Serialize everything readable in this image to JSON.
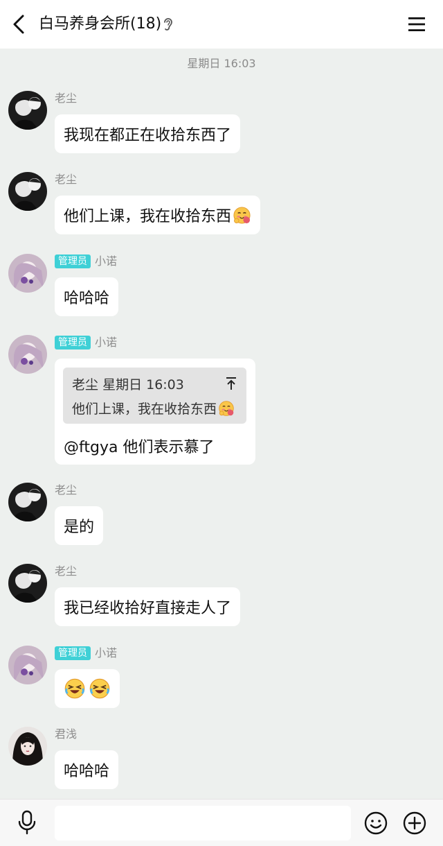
{
  "header": {
    "title": "白马养身会所(18)",
    "back_icon": "chevron-left-icon",
    "ear_icon": "ear-icon",
    "menu_icon": "hamburger-menu-icon"
  },
  "timestamp": "星期日 16:03",
  "messages": [
    {
      "sender": "老尘",
      "badge": "",
      "text": "我现在都正在收拾东西了",
      "emoji": ""
    },
    {
      "sender": "老尘",
      "badge": "",
      "text": "他们上课，我在收拾东西",
      "emoji": "hugging-face-emoji"
    },
    {
      "sender": "小诺",
      "badge": "管理员",
      "text": "哈哈哈",
      "emoji": ""
    },
    {
      "sender": "小诺",
      "badge": "管理员",
      "quote": {
        "author": "老尘",
        "time": "星期日 16:03",
        "text": "他们上课，我在收拾东西",
        "emoji": "hugging-face-emoji",
        "jump_icon": "jump-to-top-icon"
      },
      "text": "@ftgya 他们表示慕了"
    },
    {
      "sender": "老尘",
      "badge": "",
      "text": "是的",
      "emoji": ""
    },
    {
      "sender": "老尘",
      "badge": "",
      "text": "我已经收拾好直接走人了",
      "emoji": ""
    },
    {
      "sender": "小诺",
      "badge": "管理员",
      "text": "",
      "emoji": "laughing-tears-emoji x2"
    },
    {
      "sender": "君浅",
      "badge": "",
      "text": "哈哈哈",
      "emoji": ""
    }
  ],
  "composer": {
    "placeholder": "",
    "mic_icon": "microphone-icon",
    "emoji_icon": "smiley-icon",
    "plus_icon": "plus-circle-icon"
  },
  "colors": {
    "background": "#edf0ee",
    "bubble": "#ffffff",
    "admin_badge": "#3fd0d6",
    "sender_name": "#8d8d8d"
  }
}
